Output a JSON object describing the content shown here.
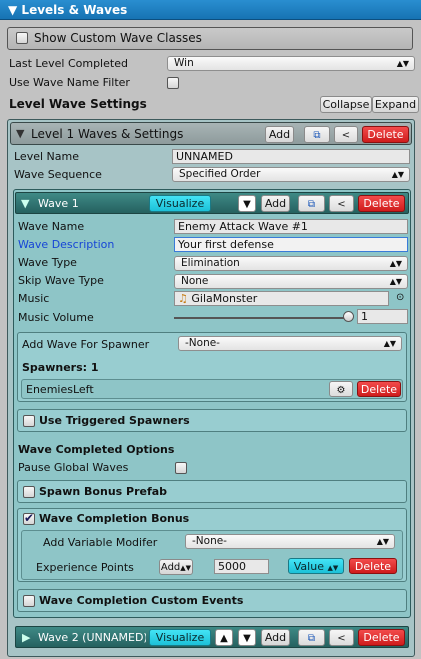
{
  "header": {
    "title": "Levels & Waves"
  },
  "show_custom_wave_classes": {
    "label": "Show Custom Wave Classes"
  },
  "last_level_completed": {
    "label": "Last Level Completed",
    "value": "Win"
  },
  "use_wave_name_filter": {
    "label": "Use Wave Name Filter"
  },
  "level_wave_settings": {
    "title": "Level Wave Settings",
    "collapse": "Collapse",
    "expand": "Expand"
  },
  "level1": {
    "title": "Level 1 Waves & Settings",
    "add": "Add",
    "delete": "Delete",
    "level_name_label": "Level Name",
    "level_name_value": "UNNAMED",
    "wave_sequence_label": "Wave Sequence",
    "wave_sequence_value": "Specified Order"
  },
  "wave1": {
    "title": "Wave 1",
    "visualize": "Visualize",
    "add": "Add",
    "delete": "Delete",
    "fields": {
      "wave_name_label": "Wave Name",
      "wave_name_value": "Enemy Attack Wave #1",
      "wave_description_label": "Wave Description",
      "wave_description_value": "Your first defense",
      "wave_type_label": "Wave Type",
      "wave_type_value": "Elimination",
      "skip_wave_type_label": "Skip Wave Type",
      "skip_wave_type_value": "None",
      "music_label": "Music",
      "music_value": "GilaMonster",
      "music_volume_label": "Music Volume",
      "music_volume_value": "1"
    },
    "music_volume_level": 1.0,
    "spawner_box": {
      "add_wave_label": "Add Wave For Spawner",
      "add_wave_value": "-None-",
      "spawners_count": "Spawners: 1",
      "spawner_name": "EnemiesLeft",
      "delete": "Delete"
    },
    "use_triggered_spawners": "Use Triggered Spawners",
    "wave_completed_options": "Wave Completed Options",
    "pause_global_waves": "Pause Global Waves",
    "spawn_bonus_prefab": "Spawn Bonus Prefab",
    "wave_completion_bonus": {
      "label": "Wave Completion Bonus",
      "add_variable_label": "Add Variable Modifer",
      "add_variable_value": "-None-",
      "experience_label": "Experience Points",
      "add_button": "Add",
      "experience_value": "5000",
      "value_dropdown": "Value",
      "delete": "Delete"
    },
    "wave_completion_custom_events": "Wave Completion Custom Events"
  },
  "wave2": {
    "title": "Wave 2 (UNNAMED)",
    "visualize": "Visualize",
    "add": "Add",
    "delete": "Delete"
  }
}
